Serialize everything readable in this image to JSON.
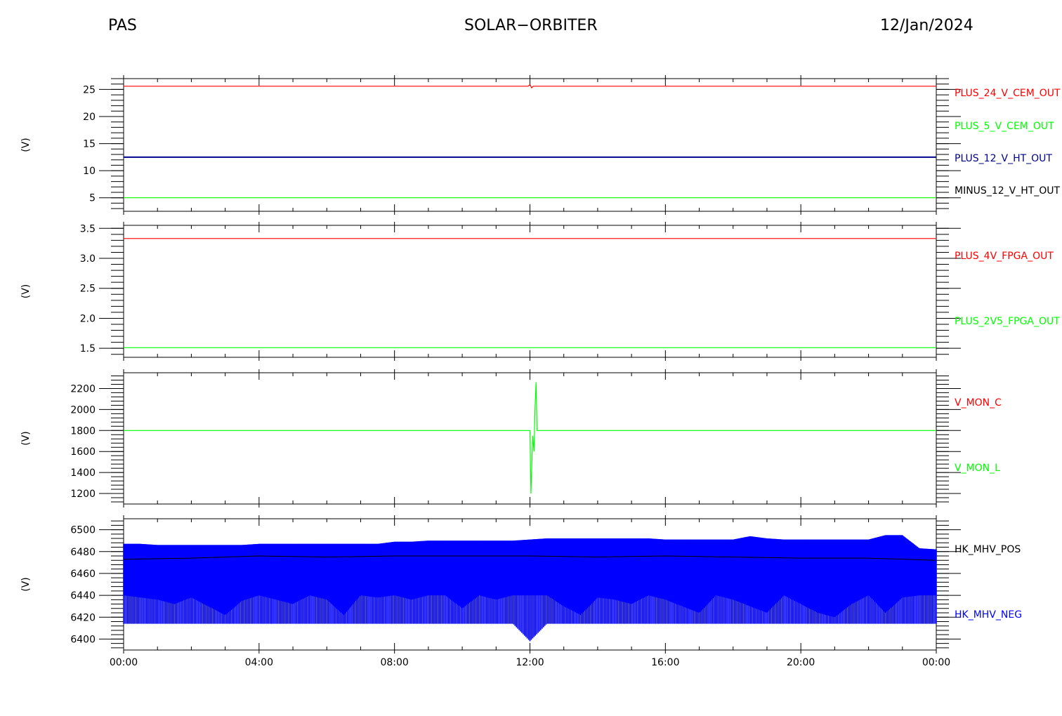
{
  "header": {
    "left": "PAS",
    "center": "SOLAR−ORBITER",
    "right": "12/Jan/2024"
  },
  "chart_data": [
    {
      "type": "line",
      "ylabel": "(V)",
      "ylim": [
        2.5,
        27
      ],
      "yticks": [
        5,
        10,
        15,
        20,
        25
      ],
      "ytick_labels": [
        "5",
        "10",
        "15",
        "20",
        "25"
      ],
      "series": [
        {
          "name": "PLUS_24_V_CEM_OUT",
          "color": "#ff0000",
          "x": [
            0,
            11.95,
            12.0,
            12.05,
            12.1,
            24
          ],
          "y": [
            25.6,
            25.6,
            25.9,
            25.3,
            25.6,
            25.6
          ]
        },
        {
          "name": "PLUS_5_V_CEM_OUT",
          "color": "#00ff00",
          "x": [
            0,
            24
          ],
          "y": [
            5.0,
            5.0
          ]
        },
        {
          "name": "PLUS_12_V_HT_OUT",
          "color": "#00008b",
          "x": [
            0,
            24
          ],
          "y": [
            12.5,
            12.5
          ]
        },
        {
          "name": "MINUS_12_V_HT_OUT",
          "color": "#000000",
          "x": [],
          "y": []
        }
      ]
    },
    {
      "type": "line",
      "ylabel": "(V)",
      "ylim": [
        1.35,
        3.55
      ],
      "yticks": [
        1.5,
        2.0,
        2.5,
        3.0,
        3.5
      ],
      "ytick_labels": [
        "1.5",
        "2.0",
        "2.5",
        "3.0",
        "3.5"
      ],
      "series": [
        {
          "name": "PLUS_4V_FPGA_OUT",
          "color": "#ff0000",
          "x": [
            0,
            24
          ],
          "y": [
            3.33,
            3.33
          ]
        },
        {
          "name": "PLUS_2V5_FPGA_OUT",
          "color": "#00ff00",
          "x": [
            0,
            24
          ],
          "y": [
            1.51,
            1.51
          ]
        }
      ]
    },
    {
      "type": "line",
      "ylabel": "(V)",
      "ylim": [
        1100,
        2350
      ],
      "yticks": [
        1200,
        1400,
        1600,
        1800,
        2000,
        2200
      ],
      "ytick_labels": [
        "1200",
        "1400",
        "1600",
        "1800",
        "2000",
        "2200"
      ],
      "series": [
        {
          "name": "V_MON_C",
          "color": "#ff0000",
          "x": [],
          "y": []
        },
        {
          "name": "V_MON_L",
          "color": "#00ff00",
          "x": [
            0,
            12.0,
            12.03,
            12.08,
            12.12,
            12.15,
            12.18,
            12.21,
            24
          ],
          "y": [
            1800,
            1800,
            1200,
            1750,
            1600,
            2000,
            2260,
            1800,
            1800
          ]
        }
      ]
    },
    {
      "type": "area",
      "ylabel": "(V)",
      "ylim": [
        6390,
        6510
      ],
      "yticks": [
        6400,
        6420,
        6440,
        6460,
        6480,
        6500
      ],
      "ytick_labels": [
        "6400",
        "6420",
        "6440",
        "6460",
        "6480",
        "6500"
      ],
      "xlim": [
        0,
        24
      ],
      "xticks": [
        0,
        4,
        8,
        12,
        16,
        20,
        24
      ],
      "xtick_labels": [
        "00:00",
        "04:00",
        "08:00",
        "12:00",
        "16:00",
        "20:00",
        "00:00"
      ],
      "series": [
        {
          "name": "HK_MHV_POS",
          "color": "#000000",
          "x": [
            0,
            2,
            4,
            6,
            8,
            10,
            12,
            14,
            16,
            18,
            20,
            22,
            24
          ],
          "y": [
            6473,
            6474,
            6476,
            6475,
            6476,
            6476,
            6476,
            6475,
            6476,
            6475,
            6474,
            6474,
            6472
          ]
        },
        {
          "name": "HK_MHV_NEG",
          "color": "#0000ff",
          "x": [
            0,
            0.5,
            1.0,
            1.5,
            2.0,
            2.5,
            3.0,
            3.5,
            4.0,
            4.5,
            5.0,
            5.5,
            6.0,
            6.5,
            7.0,
            7.5,
            8.0,
            8.5,
            9.0,
            9.5,
            10.0,
            10.5,
            11.0,
            11.5,
            12.0,
            12.5,
            13.0,
            13.5,
            14.0,
            14.5,
            15.0,
            15.5,
            16.0,
            16.5,
            17.0,
            17.5,
            18.0,
            18.5,
            19.0,
            19.5,
            20.0,
            20.5,
            21.0,
            21.5,
            22.0,
            22.5,
            23.0,
            23.5,
            24.0
          ],
          "y_max": [
            6487,
            6487,
            6486,
            6486,
            6486,
            6486,
            6486,
            6486,
            6487,
            6487,
            6487,
            6487,
            6487,
            6487,
            6487,
            6487,
            6489,
            6489,
            6490,
            6490,
            6490,
            6490,
            6490,
            6490,
            6491,
            6492,
            6492,
            6492,
            6492,
            6492,
            6492,
            6492,
            6491,
            6491,
            6491,
            6491,
            6491,
            6494,
            6492,
            6491,
            6491,
            6491,
            6491,
            6491,
            6491,
            6495,
            6495,
            6483,
            6482
          ],
          "y_min": [
            6414,
            6414,
            6414,
            6414,
            6414,
            6414,
            6414,
            6414,
            6414,
            6414,
            6414,
            6414,
            6414,
            6414,
            6414,
            6414,
            6414,
            6414,
            6414,
            6414,
            6414,
            6414,
            6414,
            6414,
            6398,
            6414,
            6414,
            6414,
            6414,
            6414,
            6414,
            6414,
            6414,
            6414,
            6414,
            6414,
            6414,
            6414,
            6414,
            6414,
            6414,
            6414,
            6414,
            6414,
            6414,
            6414,
            6414,
            6414,
            6414
          ],
          "envelope_low": [
            6440,
            6438,
            6436,
            6432,
            6438,
            6430,
            6422,
            6435,
            6440,
            6436,
            6432,
            6440,
            6436,
            6422,
            6440,
            6438,
            6440,
            6436,
            6440,
            6440,
            6428,
            6440,
            6436,
            6440,
            6440,
            6440,
            6430,
            6422,
            6438,
            6436,
            6432,
            6440,
            6436,
            6430,
            6424,
            6440,
            6436,
            6430,
            6424,
            6440,
            6432,
            6424,
            6420,
            6432,
            6440,
            6424,
            6438,
            6440,
            6440
          ]
        }
      ]
    }
  ]
}
